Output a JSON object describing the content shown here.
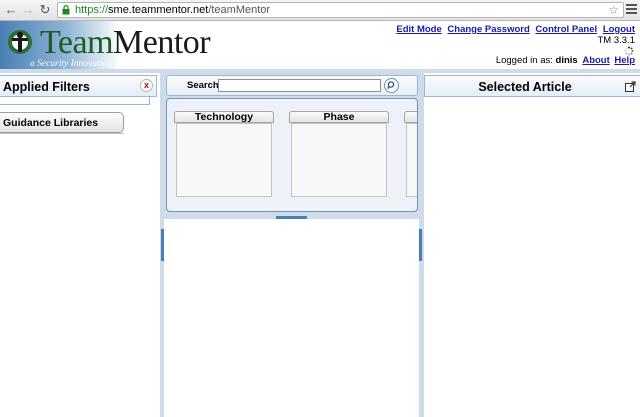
{
  "browser": {
    "url_scheme": "https://",
    "url_host": "sme.teammentor.net",
    "url_path": "/teamMentor",
    "icons": [
      "back-arrow-icon",
      "forward-arrow-icon",
      "reload-icon",
      "lock-icon",
      "bookmark-star-icon",
      "menu-icon"
    ]
  },
  "header": {
    "logo_team": "Team",
    "logo_mentor": "Mentor",
    "logo_tagline": "a Security Innovation eKnowledge Product",
    "links": {
      "edit_mode": "Edit Mode",
      "change_password": "Change Password",
      "control_panel": "Control Panel",
      "logout": "Logout"
    },
    "version": "TM 3.3.1",
    "user": {
      "prefix": "Logged in as:",
      "name": "dinis",
      "about": "About",
      "help": "Help"
    }
  },
  "left_panel": {
    "applied_filters_title": "Applied Filters",
    "close_glyph": "x",
    "guidance_libraries_label": "Guidance Libraries"
  },
  "middle_panel": {
    "search_label": "Search",
    "search_value": "",
    "facets": [
      {
        "title": "Technology"
      },
      {
        "title": "Phase"
      },
      {
        "title": ""
      }
    ]
  },
  "right_panel": {
    "selected_article_title": "Selected Article"
  },
  "colors": {
    "accent_blue": "#4a7fb4",
    "panel_border": "#9db8d6",
    "link": "#1a1aa6",
    "secure_green": "#1e8a1e"
  }
}
